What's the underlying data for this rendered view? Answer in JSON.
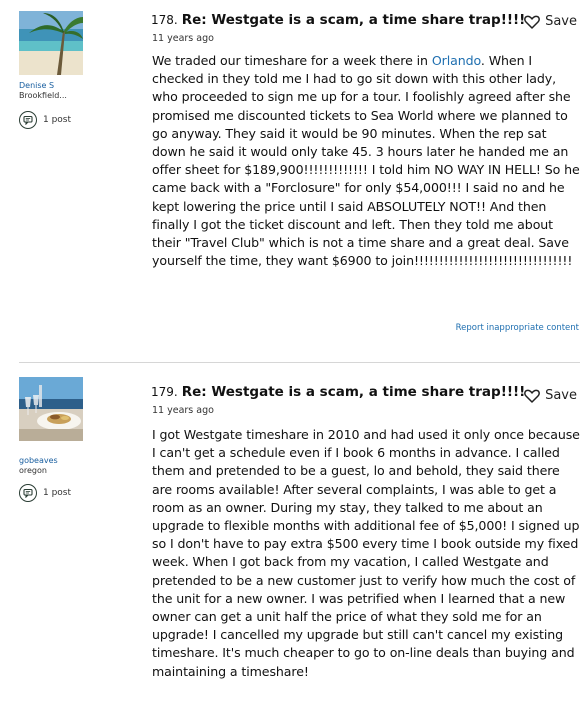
{
  "posts": [
    {
      "number": "178.",
      "title": "Re: Westgate is a scam, a time share trap!!!!",
      "save_label": "Save",
      "timestamp": "11 years ago",
      "username": "Denise S",
      "location": "Brookfield...",
      "post_count": "1 post",
      "body_before_link": "We traded our timeshare for a week there in ",
      "link_text": "Orlando",
      "body_after_link": ". When I checked in they told me I had to go sit down with this other lady, who proceeded to sign me up for a tour. I foolishly agreed after she promised me discounted tickets to Sea World where we planned to go anyway. They said it would be 90 minutes. When the rep sat down he said it would only take 45. 3 hours later he handed me an offer sheet for $189,900!!!!!!!!!!!!! I told him NO WAY IN HELL! So he came back with a \"Forclosure\" for only $54,000!!! I said no and he kept lowering the price until I said ABSOLUTELY NOT!! And then finally I got the ticket discount and left. Then they told me about their \"Travel Club\" which is not a time share and a great deal. Save yourself the time, they want $6900 to join!!!!!!!!!!!!!!!!!!!!!!!!!!!!!!!!",
      "report_label": "Report inappropriate content"
    },
    {
      "number": "179.",
      "title": "Re: Westgate is a scam, a time share trap!!!!",
      "save_label": "Save",
      "timestamp": "11 years ago",
      "username": "gobeaves",
      "location": "oregon",
      "post_count": "1 post",
      "body": "I got Westgate timeshare in 2010 and had used it only once because I can't get a schedule even if I book 6 months in advance. I called them and pretended to be a guest, lo and behold, they said there are rooms available! After several complaints, I was able to get a room as an owner. During my stay, they talked to me about an upgrade to flexible months with additional fee of $5,000! I signed up so I don't have to pay extra $500 every time I book outside my fixed week. When I got back from my vacation, I called Westgate and pretended to be a new customer just to verify how much the cost of the unit for a new owner. I was petrified when I learned that a new owner can get a unit half the price of what they sold me for an upgrade! I cancelled my upgrade but still can't cancel my existing timeshare. It's much cheaper to go to on-line deals than buying and maintaining a timeshare!"
    }
  ]
}
